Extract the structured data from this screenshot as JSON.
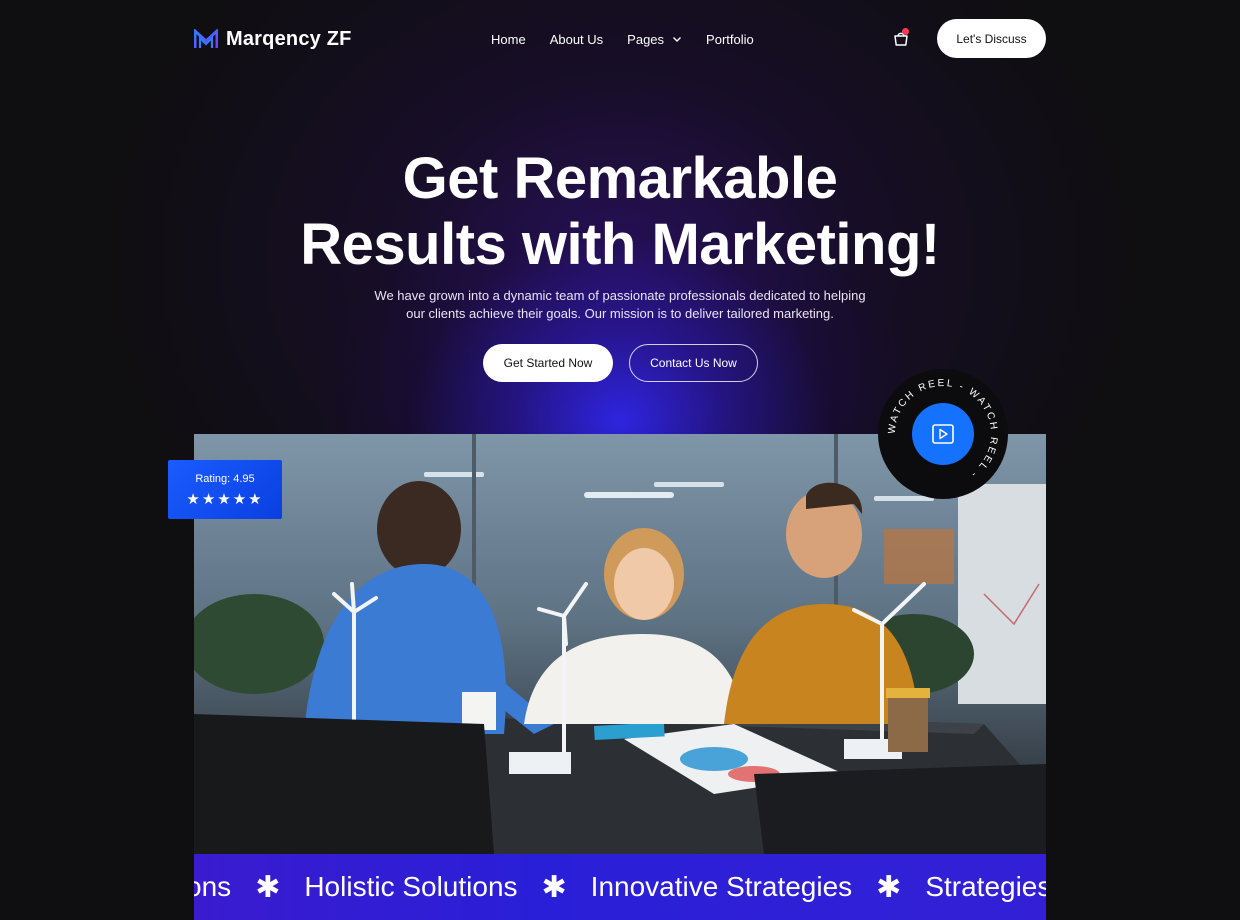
{
  "brand": {
    "name": "Marqency ZF"
  },
  "nav": {
    "items": [
      {
        "label": "Home"
      },
      {
        "label": "About Us"
      },
      {
        "label": "Pages"
      },
      {
        "label": "Portfolio"
      }
    ],
    "cta_label": "Let's Discuss"
  },
  "hero": {
    "title_line1": "Get Remarkable",
    "title_line2": "Results with Marketing!",
    "subtitle_line1": "We have grown into a dynamic team of passionate professionals dedicated to helping",
    "subtitle_line2": "our clients achieve their goals. Our mission is to deliver tailored marketing.",
    "primary_label": "Get Started Now",
    "secondary_label": "Contact Us Now"
  },
  "rating": {
    "label": "Rating: 4.95",
    "stars": "★★★★★"
  },
  "reel": {
    "text": "WATCH REEL - WATCH REEL - "
  },
  "marquee": {
    "items": [
      "Solutions",
      "Holistic Solutions",
      "Innovative Strategies",
      "Strategies"
    ],
    "separator": "✱"
  },
  "colors": {
    "accent": "#1472ff",
    "marquee": "#3320d6",
    "badge": "#ff3a55"
  },
  "icons": [
    "logo-mark-icon",
    "chevron-down-icon",
    "cart-icon",
    "play-icon",
    "star-icon"
  ]
}
